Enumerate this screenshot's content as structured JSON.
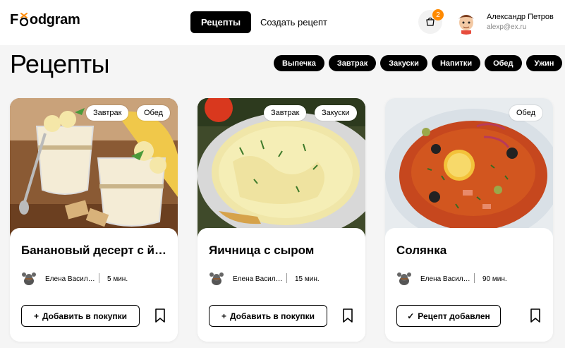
{
  "header": {
    "logo": "Foodgram",
    "nav_active": "Рецепты",
    "nav_create": "Создать рецепт",
    "cart_count": "2",
    "user_name": "Александр Петров",
    "user_email": "alexp@ex.ru"
  },
  "page": {
    "title": "Рецепты",
    "filters": [
      "Выпечка",
      "Завтрак",
      "Закуски",
      "Напитки",
      "Обед",
      "Ужин"
    ]
  },
  "cards": [
    {
      "title": "Банановый десерт с йогуртом",
      "tags": [
        "Завтрак",
        "Обед"
      ],
      "author": "Елена Васильева",
      "time": "5 мин.",
      "button": "Добавить в покупки",
      "button_icon": "plus-icon"
    },
    {
      "title": "Яичница с сыром",
      "tags": [
        "Завтрак",
        "Закуски"
      ],
      "author": "Елена Васильева",
      "time": "15 мин.",
      "button": "Добавить в покупки",
      "button_icon": "plus-icon"
    },
    {
      "title": "Солянка",
      "tags": [
        "Обед"
      ],
      "author": "Елена Васильева",
      "time": "90 мин.",
      "button": "Рецепт добавлен",
      "button_icon": "check-icon"
    }
  ],
  "colors": {
    "accent": "#000000",
    "badge": "#ff8a00",
    "background": "#f5f5f5"
  }
}
